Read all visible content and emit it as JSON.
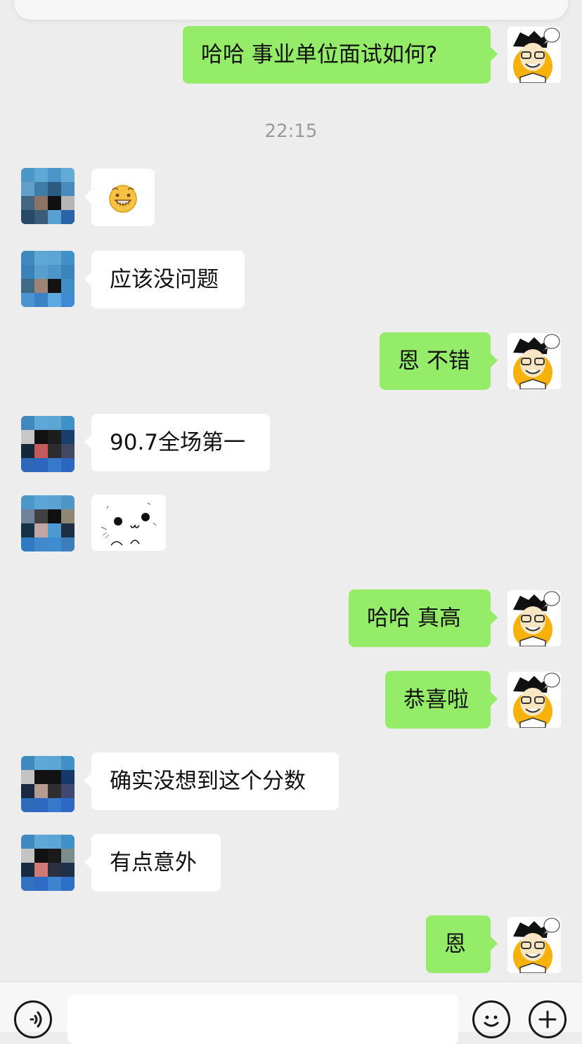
{
  "chat": {
    "timestamp": "22:15",
    "messages": [
      {
        "side": "right",
        "text": "哈哈 事业单位面试如何?"
      },
      {
        "side": "left",
        "type": "emoji",
        "emoji": "grin-emoji"
      },
      {
        "side": "left",
        "text": "应该没问题"
      },
      {
        "side": "right",
        "text": "恩 不错"
      },
      {
        "side": "left",
        "text": "90.7全场第一"
      },
      {
        "side": "left",
        "type": "sticker",
        "sticker": "seal-sticker"
      },
      {
        "side": "right",
        "text": "哈哈  真高"
      },
      {
        "side": "right",
        "text": "恭喜啦"
      },
      {
        "side": "left",
        "text": "确实没想到这个分数"
      },
      {
        "side": "left",
        "text": "有点意外"
      },
      {
        "side": "right",
        "text": "恩"
      }
    ]
  },
  "colors": {
    "background": "#ededed",
    "outgoing_bubble": "#95ec69",
    "incoming_bubble": "#ffffff",
    "timestamp_text": "#9a9a9a"
  },
  "icons": {
    "voice": "voice-icon",
    "emoji": "emoji-icon",
    "plus": "plus-icon"
  }
}
